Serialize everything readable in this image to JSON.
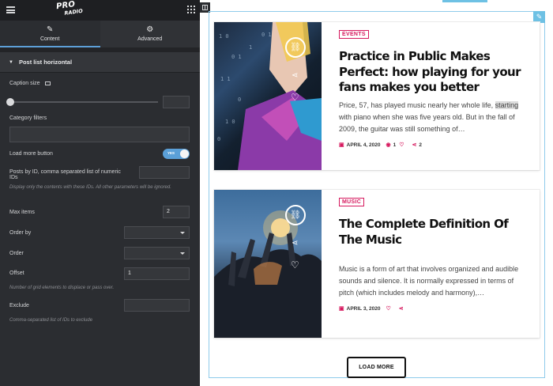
{
  "editor": {
    "logo": {
      "line1": "PRO",
      "line2": "RADIO"
    },
    "tabs": [
      {
        "label": "Content",
        "icon": "pencil-icon"
      },
      {
        "label": "Advanced",
        "icon": "gear-icon"
      }
    ],
    "section_title": "Post list horizontal",
    "caption_size": {
      "label": "Caption size",
      "value": ""
    },
    "category_filters": {
      "label": "Category filters",
      "value": ""
    },
    "load_more": {
      "label": "Load more button",
      "toggle_text": "YES",
      "on": true
    },
    "posts_by_id": {
      "label": "Posts by ID, comma separated list of numeric IDs",
      "value": "",
      "note": "Display only the contents with these IDs. All other parameters will be ignored."
    },
    "max_items": {
      "label": "Max items",
      "value": "2"
    },
    "order_by": {
      "label": "Order by",
      "value": ""
    },
    "order": {
      "label": "Order",
      "value": ""
    },
    "offset": {
      "label": "Offset",
      "value": "1",
      "note": "Number of grid elements to displace or pass over."
    },
    "exclude": {
      "label": "Exclude",
      "value": "",
      "note": "Comma-separated list of IDs to exclude"
    }
  },
  "posts": [
    {
      "category": "EVENTS",
      "title": "Practice in Public Makes Perfect: how playing for your fans makes you better",
      "excerpt_before": "Price, 57, has played music nearly her whole life, ",
      "excerpt_highlight": "starting",
      "excerpt_after": " with piano when she was five years old. But in the fall of 2009, the guitar was still something of…",
      "date": "APRIL 4, 2020",
      "views": "1",
      "shares": "2"
    },
    {
      "category": "MUSIC",
      "title": "The Complete Definition Of The Music",
      "excerpt": "Music is a form of art that involves organized and audible sounds and silence. It is normally expressed in terms of pitch (which includes melody and harmony),…",
      "date": "APRIL 3, 2020"
    }
  ],
  "load_more_label": "LOAD MORE",
  "colors": {
    "accent": "#d6195e",
    "editor_bg": "#2b2d31",
    "highlight_blue": "#6ec1e4"
  }
}
